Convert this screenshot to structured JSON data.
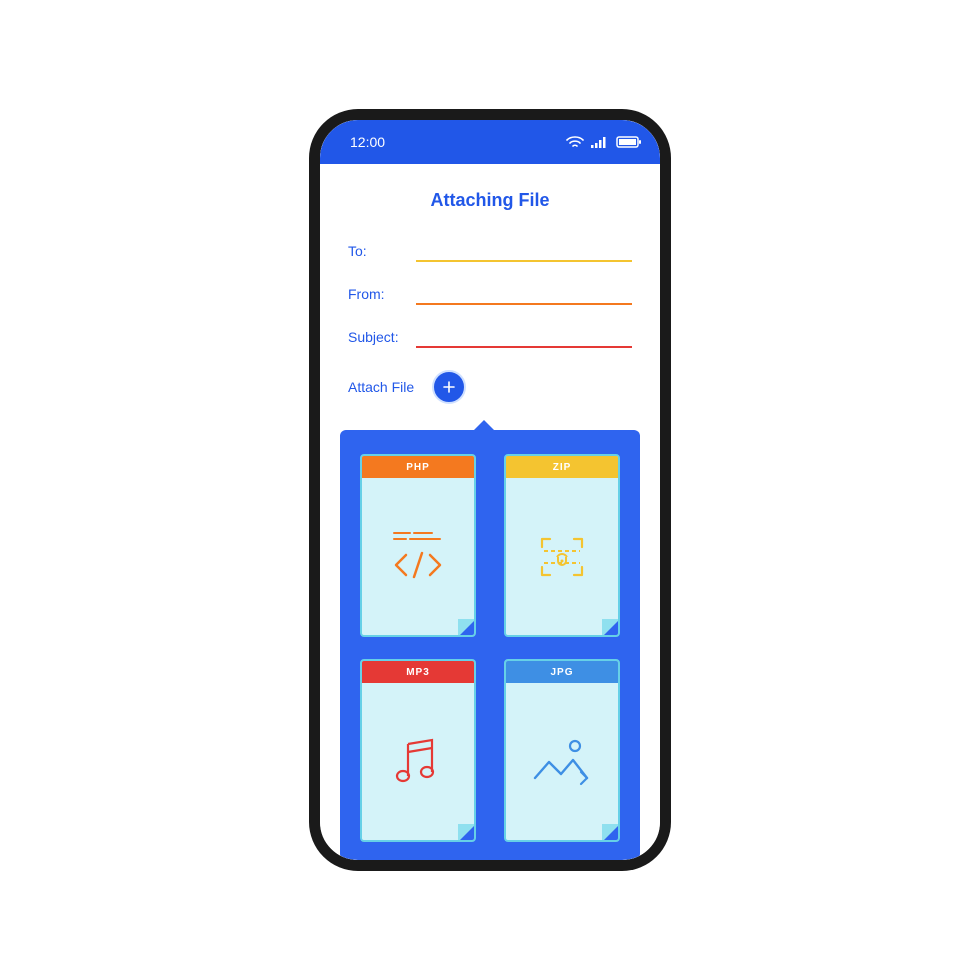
{
  "status": {
    "time": "12:00"
  },
  "title": "Attaching File",
  "fields": {
    "to_label": "To:",
    "from_label": "From:",
    "subject_label": "Subject:"
  },
  "attach": {
    "label": "Attach File"
  },
  "file_types": {
    "php": "PHP",
    "zip": "ZIP",
    "mp3": "MP3",
    "jpg": "JPG"
  },
  "colors": {
    "primary": "#2157e8",
    "panel": "#2f64ef",
    "yellow": "#f4c430",
    "orange": "#f4791f",
    "red": "#e53935",
    "blue": "#3e8fe4",
    "file_bg": "#d4f3f9",
    "file_border": "#66d0e7"
  }
}
